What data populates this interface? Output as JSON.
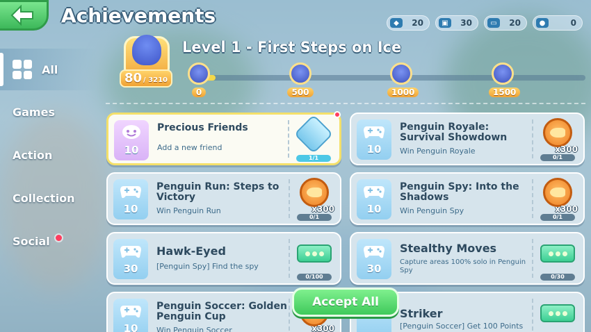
{
  "header": {
    "title": "Achievements",
    "back_icon": "back-arrow-icon"
  },
  "currencies": [
    {
      "icon": "gamepad-icon",
      "value": "20"
    },
    {
      "icon": "clapper-icon",
      "value": "30"
    },
    {
      "icon": "card-icon",
      "value": "20"
    },
    {
      "icon": "chat-icon",
      "value": "0"
    }
  ],
  "sidebar": {
    "items": [
      {
        "label": "All",
        "active": true
      },
      {
        "label": "Games"
      },
      {
        "label": "Action"
      },
      {
        "label": "Collection"
      },
      {
        "label": "Social",
        "notification": true
      }
    ]
  },
  "level": {
    "title": "Level 1 - First Steps on Ice",
    "current_points": "80",
    "max_points": "/ 3210",
    "progress_fraction": 0.05,
    "milestones": [
      "0",
      "500",
      "1000",
      "1500"
    ]
  },
  "achievements": [
    {
      "name": "Precious Friends",
      "desc": "Add a new friend",
      "points": "10",
      "reward": "badge",
      "progress": "1/1",
      "complete": true,
      "highlight": true,
      "notification": true
    },
    {
      "name": "Penguin Royale: Survival Showdown",
      "desc": "Win Penguin Royale",
      "points": "10",
      "reward": "coin",
      "multiplier": "x300",
      "progress": "0/1"
    },
    {
      "name": "Penguin Run: Steps to Victory",
      "desc": "Win Penguin Run",
      "points": "10",
      "reward": "coin",
      "multiplier": "x300",
      "progress": "0/1"
    },
    {
      "name": "Penguin Spy: Into the Shadows",
      "desc": "Win Penguin Spy",
      "points": "10",
      "reward": "coin",
      "multiplier": "x300",
      "progress": "0/1"
    },
    {
      "name": "Hawk-Eyed",
      "desc": "[Penguin Spy] Find the spy",
      "points": "30",
      "reward": "ticket",
      "progress": "0/100"
    },
    {
      "name": "Stealthy Moves",
      "desc": "Capture areas 100% solo in Penguin Spy",
      "points": "30",
      "reward": "ticket",
      "progress": "0/30"
    },
    {
      "name": "Penguin Soccer: Golden Penguin Cup",
      "desc": "Win Penguin Soccer",
      "points": "10",
      "reward": "coin",
      "multiplier": "x300",
      "progress": ""
    },
    {
      "name": "Striker",
      "desc": "[Penguin Soccer] Get 100 Points",
      "points": "",
      "reward": "ticket",
      "progress": ""
    }
  ],
  "actions": {
    "accept_all": "Accept All"
  }
}
